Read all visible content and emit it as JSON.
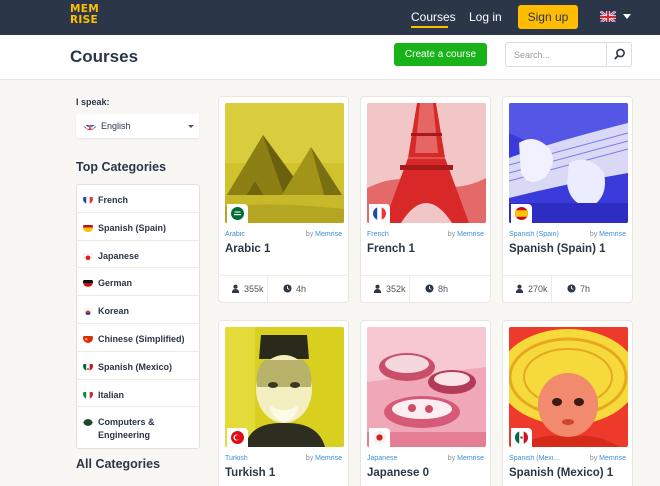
{
  "nav": {
    "logo_line1": "MEM",
    "logo_line2": "RISE",
    "courses": "Courses",
    "login": "Log in",
    "signup": "Sign up",
    "accent_color": "#ffc000"
  },
  "header": {
    "title": "Courses",
    "create_course": "Create a course",
    "search_placeholder": "Search..."
  },
  "sidebar": {
    "speak_label": "I speak:",
    "speak_value": "English",
    "top_categories_heading": "Top Categories",
    "categories": [
      {
        "label": "French",
        "flag": "flag-france-icon"
      },
      {
        "label": "Spanish (Spain)",
        "flag": "flag-spain-icon"
      },
      {
        "label": "Japanese",
        "flag": "flag-japan-icon"
      },
      {
        "label": "German",
        "flag": "flag-germany-icon"
      },
      {
        "label": "Korean",
        "flag": "flag-korea-icon"
      },
      {
        "label": "Chinese (Simplified)",
        "flag": "flag-china-icon"
      },
      {
        "label": "Spanish (Mexico)",
        "flag": "flag-mexico-icon"
      },
      {
        "label": "Italian",
        "flag": "flag-italy-icon"
      },
      {
        "label": "Computers & Engineering",
        "flag": "computer-category-icon"
      }
    ],
    "all_categories_heading": "All Categories"
  },
  "courses": [
    {
      "lang": "Arabic",
      "by_prefix": "by",
      "author": "Memrise",
      "title": "Arabic 1",
      "learners": "355k",
      "time": "4h",
      "image": "pyramids-image",
      "tint": "#cfc22c"
    },
    {
      "lang": "French",
      "by_prefix": "by",
      "author": "Memrise",
      "title": "French 1",
      "learners": "352k",
      "time": "8h",
      "image": "eiffel-tower-image",
      "tint": "#e23a3a"
    },
    {
      "lang": "Spanish (Spain)",
      "by_prefix": "by",
      "author": "Memrise",
      "title": "Spanish (Spain) 1",
      "learners": "270k",
      "time": "7h",
      "image": "guitar-image",
      "tint": "#3b3bdc"
    },
    {
      "lang": "Turkish",
      "by_prefix": "by",
      "author": "Memrise",
      "title": "Turkish 1",
      "learners": "",
      "time": "",
      "image": "old-man-image",
      "tint": "#d8cf1f"
    },
    {
      "lang": "Japanese",
      "by_prefix": "by",
      "author": "Memrise",
      "title": "Japanese 0",
      "learners": "",
      "time": "",
      "image": "japanese-food-image",
      "tint": "#e66a84"
    },
    {
      "lang": "Spanish (Mexico)",
      "by_prefix": "by",
      "author": "Memrise",
      "title": "Spanish (Mexico) 1",
      "learners": "",
      "time": "",
      "image": "sombrero-child-image",
      "tint": "#ee3a2a"
    }
  ]
}
